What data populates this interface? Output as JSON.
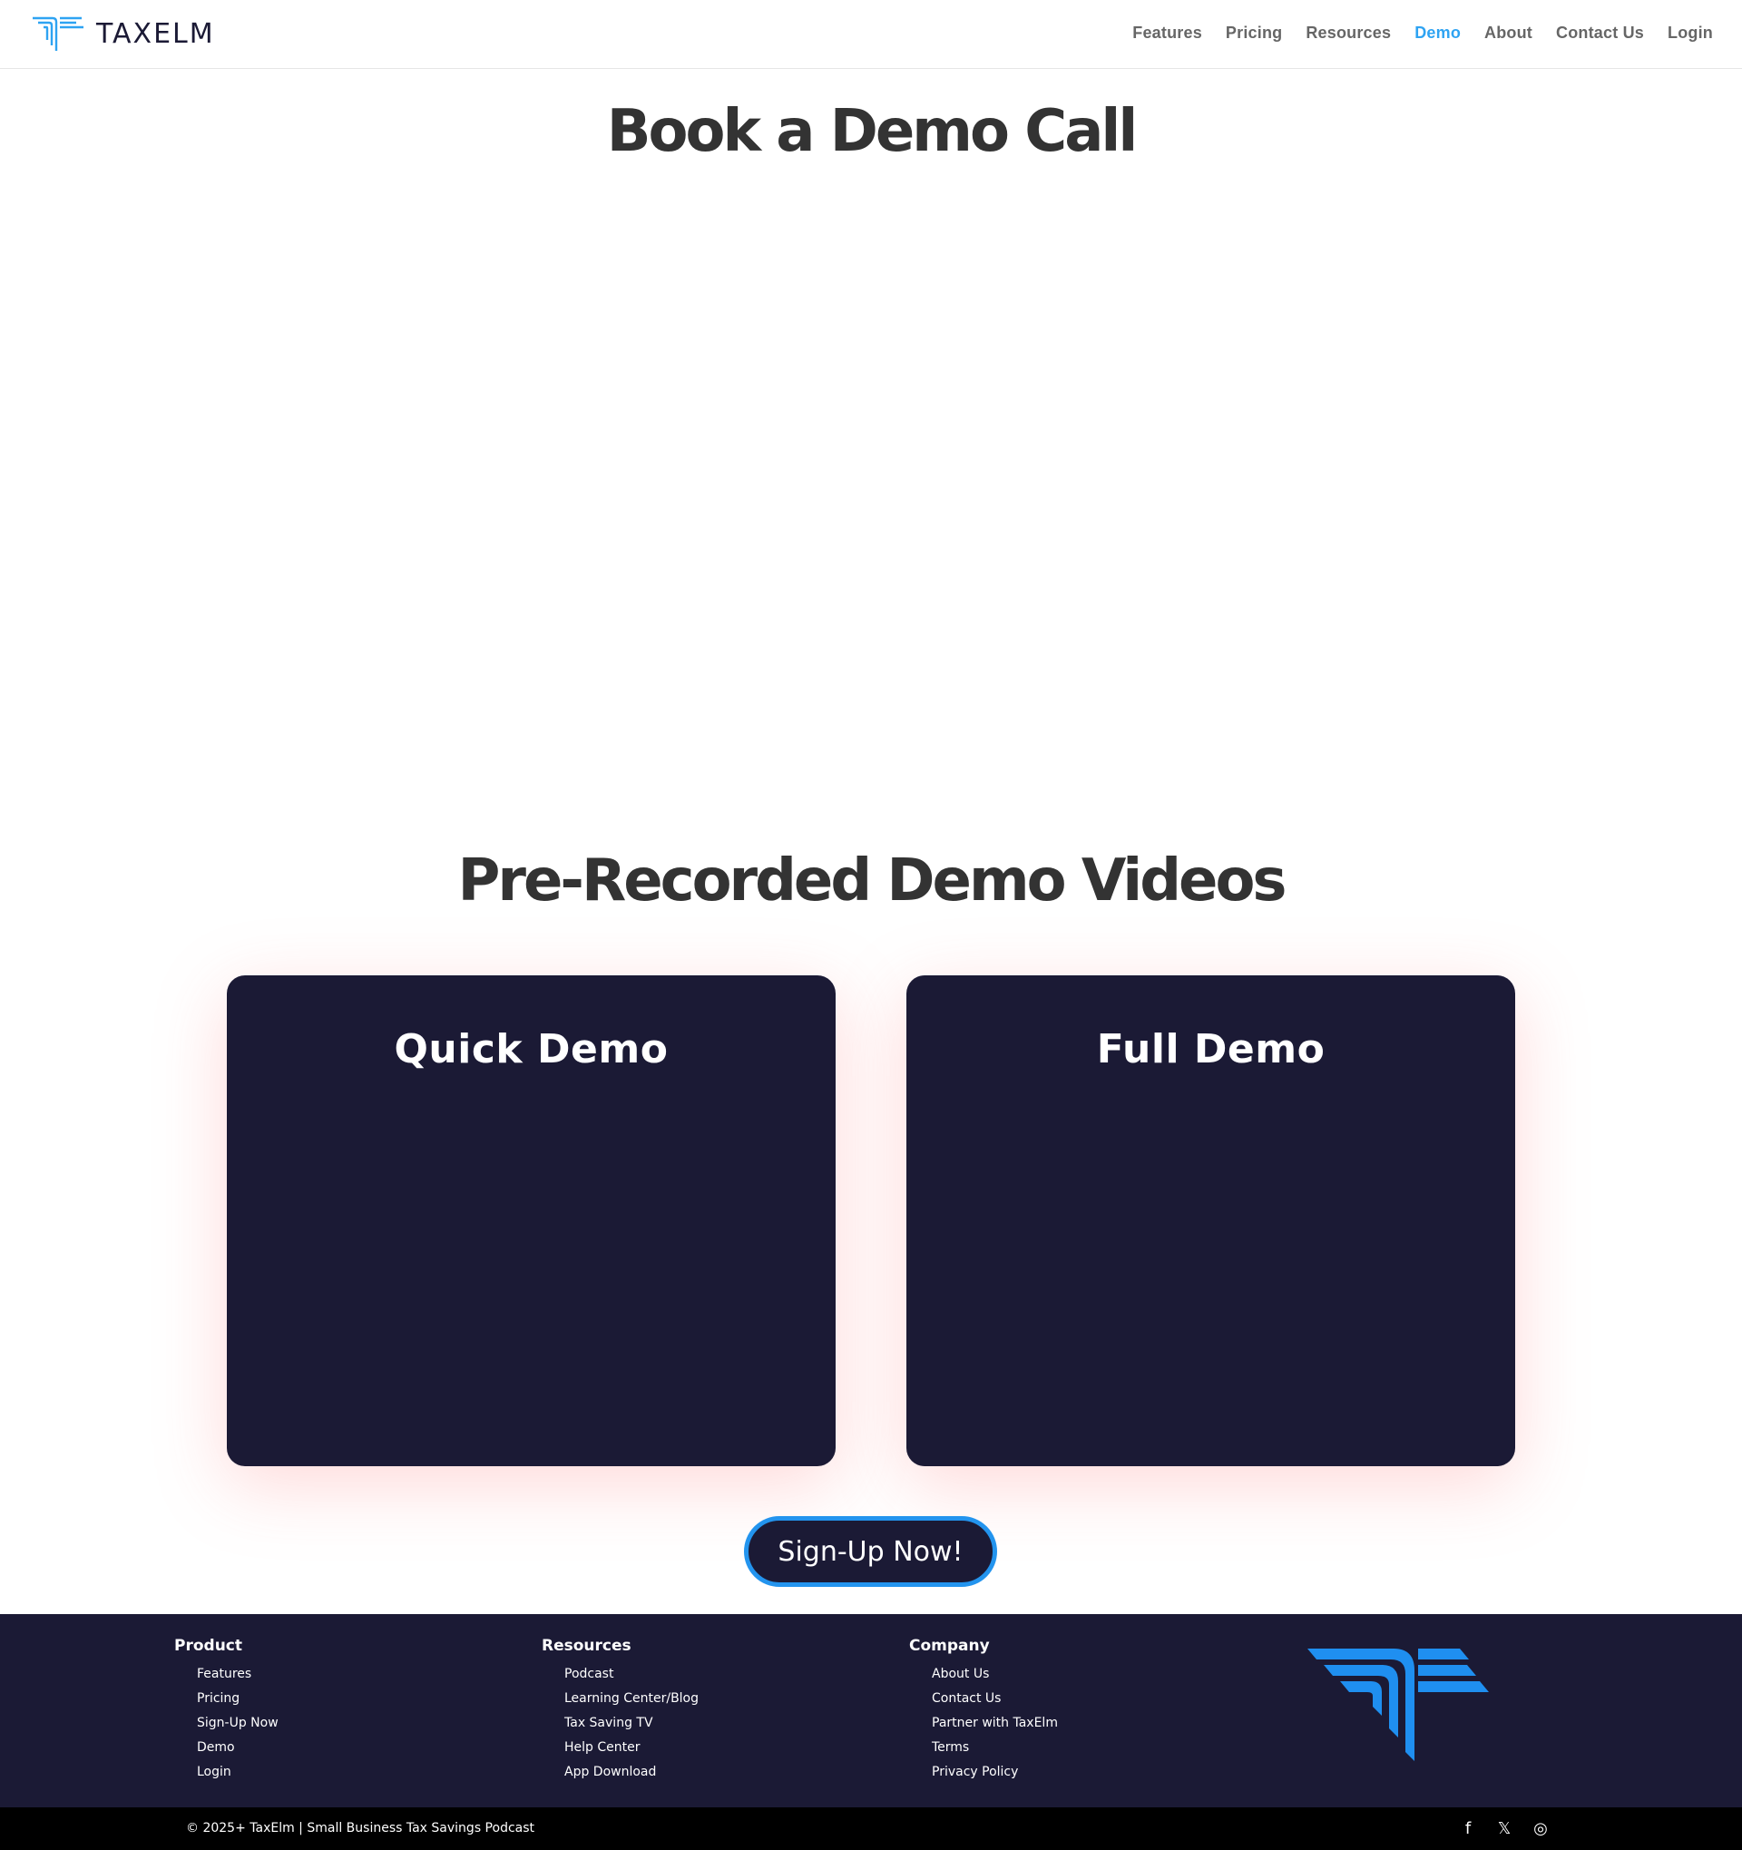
{
  "brand": {
    "name": "TAXELM",
    "accent": "#2ea3f2",
    "navy": "#1b1a35"
  },
  "nav": [
    {
      "label": "Features"
    },
    {
      "label": "Pricing"
    },
    {
      "label": "Resources"
    },
    {
      "label": "Demo",
      "active": true
    },
    {
      "label": "About"
    },
    {
      "label": "Contact Us"
    },
    {
      "label": "Login"
    }
  ],
  "main": {
    "book_title": "Book a Demo Call",
    "videos_title": "Pre-Recorded Demo Videos",
    "cards": [
      {
        "title": "Quick Demo"
      },
      {
        "title": "Full Demo"
      }
    ],
    "signup_label": "Sign-Up Now!"
  },
  "footer": {
    "columns": [
      {
        "heading": "Product",
        "links": [
          "Features",
          "Pricing",
          "Sign-Up Now",
          "Demo",
          "Login"
        ]
      },
      {
        "heading": "Resources",
        "links": [
          "Podcast",
          "Learning Center/Blog",
          "Tax Saving TV",
          "Help Center",
          "App Download"
        ]
      },
      {
        "heading": "Company",
        "links": [
          "About Us",
          "Contact Us",
          "Partner with TaxElm",
          "Terms",
          "Privacy Policy"
        ]
      }
    ],
    "copyright": "© 2025+ TaxElm | Small Business Tax Savings Podcast",
    "socials": [
      {
        "icon": "facebook-icon",
        "glyph": "f"
      },
      {
        "icon": "x-twitter-icon",
        "glyph": "𝕏"
      },
      {
        "icon": "instagram-icon",
        "glyph": "◎"
      }
    ]
  }
}
